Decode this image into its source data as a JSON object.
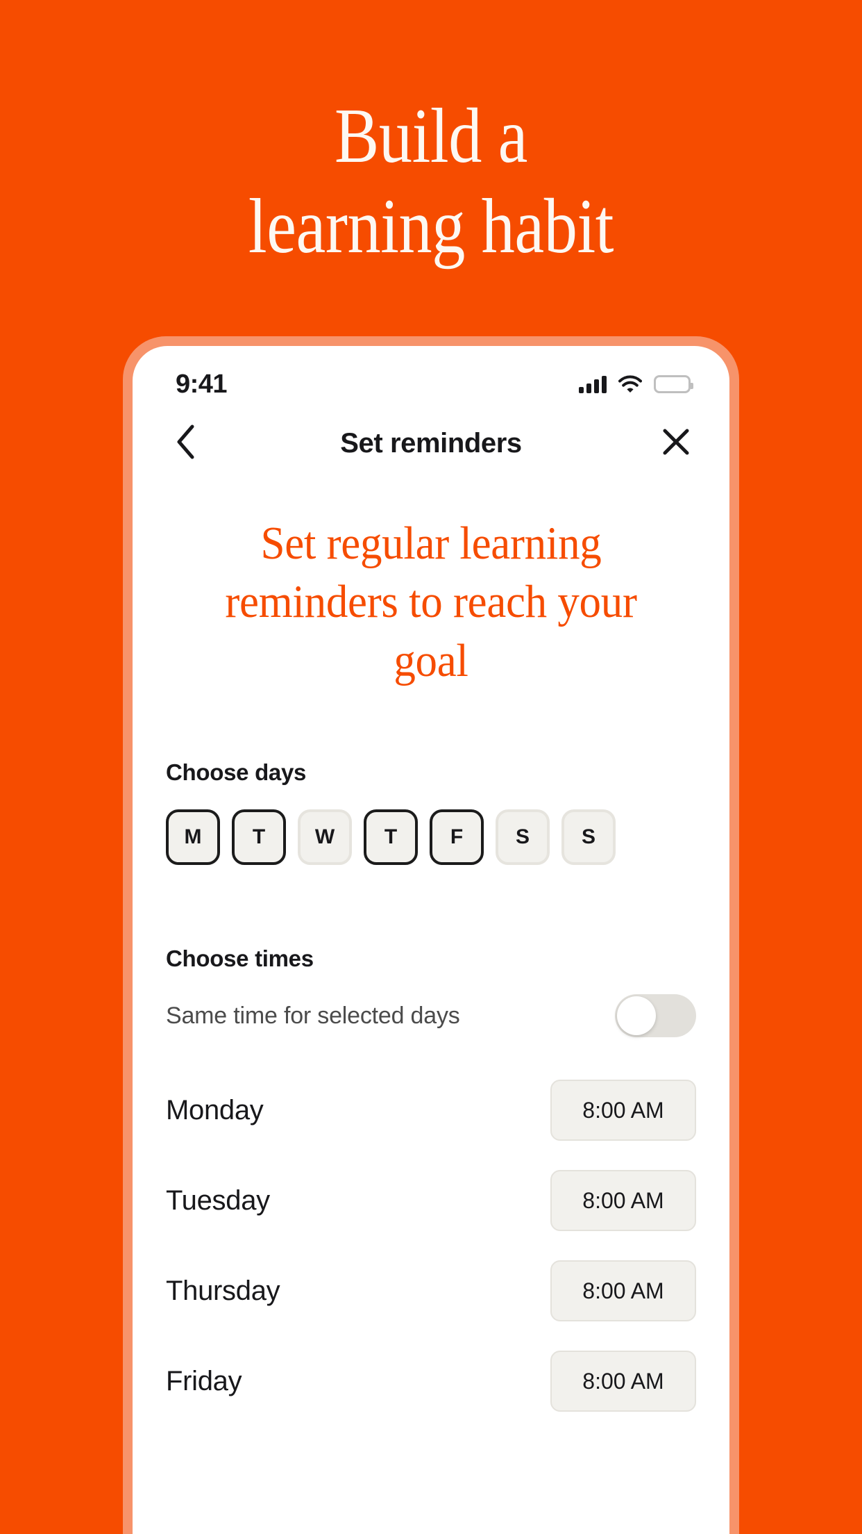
{
  "promo": {
    "headline": "Build a\nlearning habit",
    "background_color": "#F64C00",
    "text_color": "#FDF8F2"
  },
  "phone": {
    "bezel_color": "#F7936A",
    "status_bar": {
      "time": "9:41",
      "signal_icon": "cellular-signal-icon",
      "wifi_icon": "wifi-icon",
      "battery_icon": "battery-full-icon"
    },
    "nav": {
      "back_icon": "chevron-left-icon",
      "title": "Set reminders",
      "close_icon": "close-icon"
    },
    "hero": {
      "text": "Set regular learning reminders to reach your goal",
      "color": "#F64C00"
    },
    "choose_days": {
      "title": "Choose days",
      "chips": [
        {
          "label": "M",
          "selected": true
        },
        {
          "label": "T",
          "selected": true
        },
        {
          "label": "W",
          "selected": false
        },
        {
          "label": "T",
          "selected": true
        },
        {
          "label": "F",
          "selected": true
        },
        {
          "label": "S",
          "selected": false
        },
        {
          "label": "S",
          "selected": false
        }
      ]
    },
    "choose_times": {
      "title": "Choose times",
      "toggle_label": "Same time for selected days",
      "toggle_on": false,
      "rows": [
        {
          "day": "Monday",
          "time": "8:00 AM"
        },
        {
          "day": "Tuesday",
          "time": "8:00 AM"
        },
        {
          "day": "Thursday",
          "time": "8:00 AM"
        },
        {
          "day": "Friday",
          "time": "8:00 AM"
        }
      ]
    }
  }
}
